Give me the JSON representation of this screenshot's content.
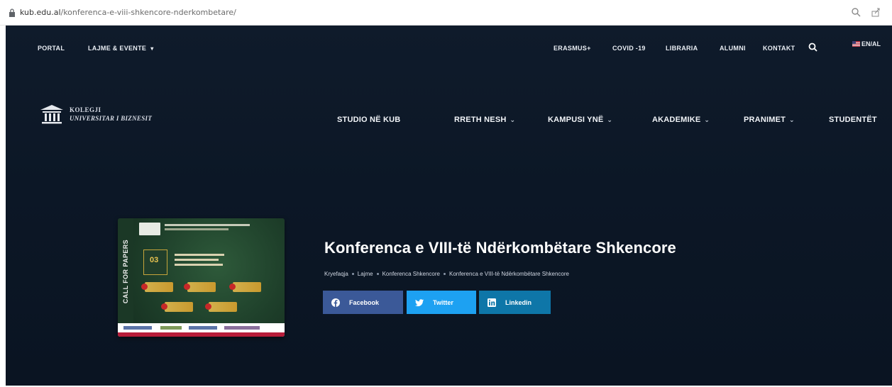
{
  "browser": {
    "url_host": "kub.edu.al",
    "url_path": "/konferenca-e-viii-shkencore-nderkombetare/"
  },
  "topbar": {
    "left": [
      {
        "label": "PORTAL"
      },
      {
        "label": "LAJME & EVENTE"
      }
    ],
    "right": [
      {
        "label": "ERASMUS+"
      },
      {
        "label": "COVID -19"
      },
      {
        "label": "LIBRARIA"
      },
      {
        "label": "ALUMNI"
      },
      {
        "label": "KONTAKT"
      }
    ],
    "language": "EN/AL"
  },
  "logo": {
    "line1": "KOLEGJI",
    "line2": "UNIVERSITAR I BIZNESIT"
  },
  "main_nav": [
    {
      "label": "STUDIO NË KUB"
    },
    {
      "label": "RRETH NESH"
    },
    {
      "label": "KAMPUSI YNË"
    },
    {
      "label": "AKADEMIKE"
    },
    {
      "label": "PRANIMET"
    },
    {
      "label": "STUDENTËT"
    }
  ],
  "poster": {
    "vertical_text": "CALL FOR PAPERS",
    "date": "03"
  },
  "page": {
    "title": "Konferenca e VIII-të Ndërkombëtare Shkencore",
    "breadcrumbs": [
      "Kryefaqja",
      "Lajme",
      "Konferenca Shkencore",
      "Konferenca e VIII-të Ndërkombëtare Shkencore"
    ]
  },
  "share": {
    "facebook": "Facebook",
    "twitter": "Twitter",
    "linkedin": "Linkedin"
  }
}
